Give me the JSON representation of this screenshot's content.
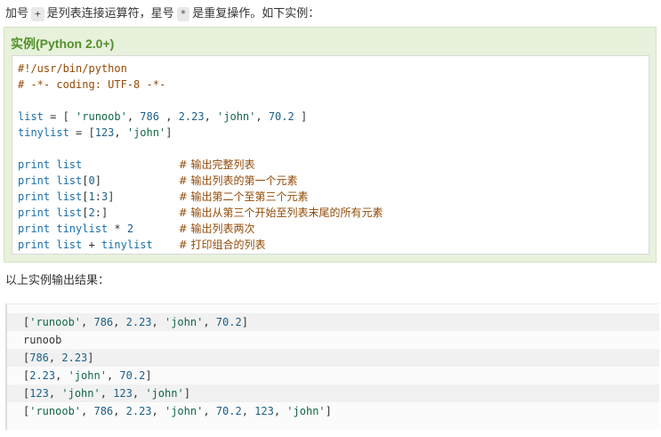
{
  "intro": {
    "part1": "加号",
    "plus_symbol": "+",
    "part2": "是列表连接运算符，星号",
    "star_symbol": "*",
    "part3": "是重复操作。如下实例："
  },
  "example": {
    "title": "实例(Python 2.0+)",
    "code_lines": [
      "#!/usr/bin/python",
      "# -*- coding: UTF-8 -*-",
      "",
      "list = [ 'runoob', 786 , 2.23, 'john', 70.2 ]",
      "tinylist = [123, 'john']",
      "",
      "print list               # 输出完整列表",
      "print list[0]            # 输出列表的第一个元素",
      "print list[1:3]          # 输出第二个至第三个元素",
      "print list[2:]           # 输出从第三个开始至列表末尾的所有元素",
      "print tinylist * 2       # 输出列表两次",
      "print list + tinylist    # 打印组合的列表"
    ]
  },
  "result_label": "以上实例输出结果：",
  "output_lines": [
    "['runoob', 786, 2.23, 'john', 70.2]",
    "runoob",
    "[786, 2.23]",
    "[2.23, 'john', 70.2]",
    "[123, 'john', 123, 'john']",
    "['runoob', 786, 2.23, 'john', 70.2, 123, 'john']"
  ],
  "colors": {
    "example_bg": "#e7f1dc",
    "title_green": "#53912a",
    "comment": "#914b07",
    "keyword": "#1a6ea8",
    "string": "#116644"
  }
}
